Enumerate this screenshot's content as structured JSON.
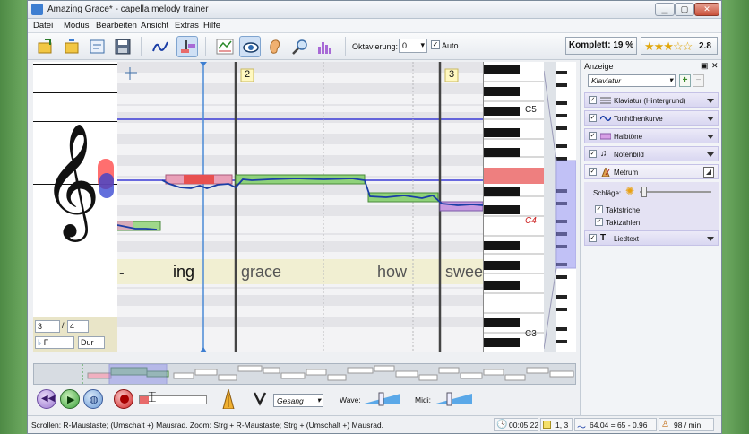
{
  "window": {
    "title": "Amazing Grace* - capella melody trainer"
  },
  "menu": [
    "Datei",
    "Modus",
    "Bearbeiten",
    "Ansicht",
    "Extras",
    "Hilfe"
  ],
  "toolbar": {
    "oktavierung_label": "Oktavierung:",
    "oktavierung_value": "0",
    "auto_label": "Auto",
    "komplett": "Komplett: 19 %",
    "stars": "★★★☆☆",
    "rating": "2.8"
  },
  "staff_controls": {
    "beats": "3",
    "unit": "4",
    "key": "F",
    "mode": "Dur"
  },
  "score": {
    "measures": [
      "2",
      "3"
    ],
    "lyrics": [
      "-",
      "ing",
      "grace",
      "how",
      "swee"
    ]
  },
  "piano": {
    "labels": [
      "C5",
      "C4",
      "C3"
    ]
  },
  "sidepanel": {
    "title": "Anzeige",
    "select": "Klaviatur",
    "plus": "+",
    "minus": "−",
    "layers": [
      {
        "label": "Klaviatur (Hintergrund)",
        "checked": "✓"
      },
      {
        "label": "Tonhöhenkurve",
        "checked": "✓"
      },
      {
        "label": "Halbtöne",
        "checked": "✓"
      },
      {
        "label": "Notenbild",
        "checked": "✓"
      },
      {
        "label": "Metrum",
        "checked": "✓"
      },
      {
        "label": "Liedtext",
        "checked": "✓"
      }
    ],
    "metrum": {
      "schlaege": "Schläge:",
      "taktstriche": "Taktstriche",
      "taktzahlen": "Taktzahlen"
    }
  },
  "transport": {
    "mode": "Gesang",
    "wave": "Wave:",
    "midi": "Midi:"
  },
  "status": {
    "help": "Scrollen: R-Maustaste; (Umschalt +) Mausrad.  Zoom: Strg + R-Maustaste; Strg + (Umschalt +) Mausrad.",
    "time": "00:05,22",
    "position": "1, 3",
    "pitch": "64.04 = 65 - 0.96",
    "tempo": "98 / min"
  },
  "colors": {
    "accent": "#3d7ed1",
    "green_note": "#8fd27a",
    "red_note": "#e86a6a",
    "pitch_curve": "#1a3ea6"
  }
}
